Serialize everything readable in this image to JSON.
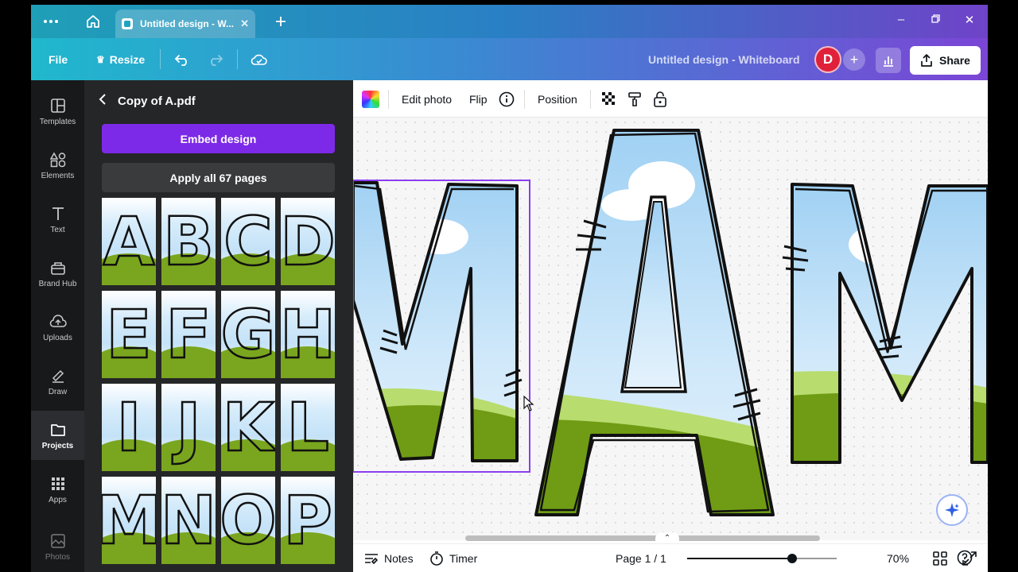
{
  "browser": {
    "tab_title": "Untitled design - W...",
    "icons": [
      "more-icon",
      "home-icon",
      "new-tab-icon",
      "minimize-icon",
      "restore-icon",
      "close-window-icon"
    ]
  },
  "toolbar": {
    "file_label": "File",
    "resize_label": "Resize",
    "document_title": "Untitled design - Whiteboard",
    "avatar_initial": "D",
    "share_label": "Share"
  },
  "rail": {
    "items": [
      {
        "label": "Templates",
        "icon": "templates-icon"
      },
      {
        "label": "Elements",
        "icon": "elements-icon"
      },
      {
        "label": "Text",
        "icon": "text-icon"
      },
      {
        "label": "Brand Hub",
        "icon": "brand-hub-icon"
      },
      {
        "label": "Uploads",
        "icon": "uploads-icon"
      },
      {
        "label": "Draw",
        "icon": "draw-icon"
      },
      {
        "label": "Projects",
        "icon": "projects-icon"
      },
      {
        "label": "Apps",
        "icon": "apps-icon"
      },
      {
        "label": "Photos",
        "icon": "photos-icon"
      }
    ],
    "active": "Projects"
  },
  "panel": {
    "title": "Copy of A.pdf",
    "embed_label": "Embed design",
    "apply_label": "Apply all 67 pages",
    "thumbnails": [
      "A",
      "B",
      "C",
      "D",
      "E",
      "F",
      "G",
      "H",
      "I",
      "J",
      "K",
      "L",
      "M",
      "N",
      "O",
      "P"
    ]
  },
  "context_bar": {
    "edit_photo": "Edit photo",
    "flip": "Flip",
    "position": "Position"
  },
  "canvas": {
    "letters": [
      "M",
      "A",
      "M"
    ]
  },
  "footer": {
    "notes_label": "Notes",
    "timer_label": "Timer",
    "page_label": "Page 1 / 1",
    "zoom_label": "70%",
    "zoom_value": 0.7
  },
  "colors": {
    "accent_purple": "#7d2ae8",
    "avatar_red": "#e0213a",
    "grass_green": "#7aa61f"
  }
}
